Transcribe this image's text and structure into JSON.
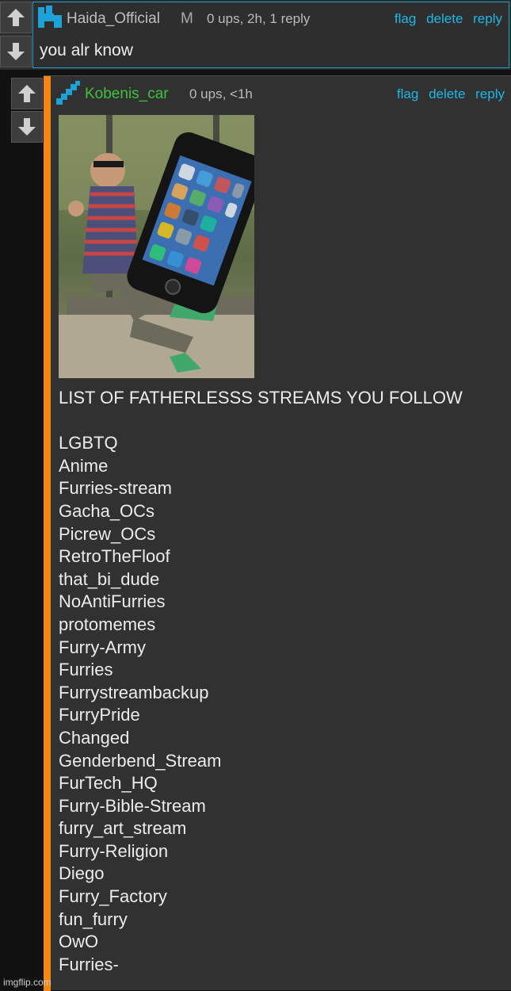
{
  "comment1": {
    "username": "Haida_Official",
    "mod_badge": "M",
    "meta": "0 ups, 2h, 1 reply",
    "actions": [
      "flag",
      "delete",
      "reply"
    ],
    "text": "you alr know",
    "username_color": "#bfbfbf",
    "border_color": "#1da1d6"
  },
  "comment2": {
    "username": "Kobenis_car",
    "meta": "0 ups, <1h",
    "actions": [
      "flag",
      "delete",
      "reply"
    ],
    "username_color": "#3ec13e",
    "indent_bar_color": "#f3870f",
    "image_icons": [
      "phone-meme-image"
    ],
    "title": "LIST OF FATHERLESSS STREAMS YOU FOLLOW",
    "streams": [
      "LGBTQ",
      "Anime",
      "Furries-stream",
      "Gacha_OCs",
      "Picrew_OCs",
      "RetroTheFloof",
      "that_bi_dude",
      "NoAntiFurries",
      "protomemes",
      "Furry-Army",
      "Furries",
      "Furrystreambackup",
      "FurryPride",
      "Changed",
      "Genderbend_Stream",
      "FurTech_HQ",
      "Furry-Bible-Stream",
      "furry_art_stream",
      "Furry-Religion",
      "Diego",
      "Furry_Factory",
      "fun_furry",
      "OwO",
      "Furries-"
    ]
  },
  "icons": {
    "upvote": "arrow-up-icon",
    "downvote": "arrow-down-icon"
  },
  "watermark": "imgflip.com"
}
